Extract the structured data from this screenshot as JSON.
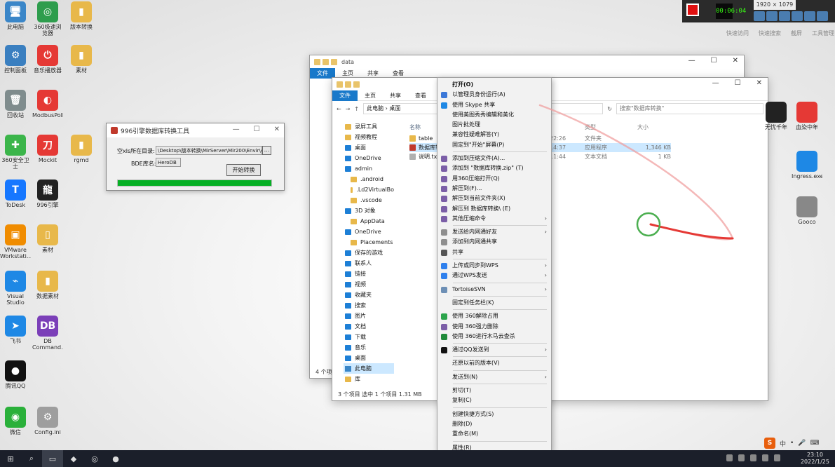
{
  "desktop_icons": [
    {
      "label": "此电脑",
      "color": "#3a86c8",
      "glyph": "🖥"
    },
    {
      "label": "360极速浏览器",
      "color": "#2e9d4d",
      "glyph": "◎"
    },
    {
      "label": "版本转换",
      "color": "#e8b84a",
      "glyph": "▮"
    },
    {
      "label": "控制面板",
      "color": "#3a7fc0",
      "glyph": "⚙"
    },
    {
      "label": "音乐播放器",
      "color": "#e53935",
      "glyph": "⏻"
    },
    {
      "label": "素材",
      "color": "#e8b84a",
      "glyph": "▮"
    },
    {
      "label": "回收站",
      "color": "#7f8c8d",
      "glyph": "🗑"
    },
    {
      "label": "ModbusPoll",
      "color": "#e53935",
      "glyph": "◐"
    },
    {
      "label": "360安全卫士",
      "color": "#3bb54a",
      "glyph": "✚"
    },
    {
      "label": "Mockit",
      "color": "#e53935",
      "glyph": "刀"
    },
    {
      "label": "rgmd",
      "color": "#e8b84a",
      "glyph": "▮"
    },
    {
      "label": "ToDesk",
      "color": "#1677ff",
      "glyph": "T"
    },
    {
      "label": "996引擎",
      "color": "#222222",
      "glyph": "龍"
    },
    {
      "label": "VMware Workstati...",
      "color": "#f08c00",
      "glyph": "▣"
    },
    {
      "label": "素材",
      "color": "#e8b84a",
      "glyph": "▯"
    },
    {
      "label": "Visual Studio Code",
      "color": "#1e88e5",
      "glyph": "⌁"
    },
    {
      "label": "数据素材",
      "color": "#e8b84a",
      "glyph": "▮"
    },
    {
      "label": "飞书",
      "color": "#1e88e5",
      "glyph": "➤"
    },
    {
      "label": "DB Command...",
      "color": "#7b3fb8",
      "glyph": "DB"
    },
    {
      "label": "腾讯QQ",
      "color": "#111111",
      "glyph": "●"
    },
    {
      "label": "微信",
      "color": "#2ab03a",
      "glyph": "◉"
    },
    {
      "label": "Config.ini",
      "color": "#9e9e9e",
      "glyph": "⚙"
    }
  ],
  "recorder": {
    "timer": "00:06:04",
    "resolution": "1920 × 1079"
  },
  "top_labels": [
    "快速访问",
    "快速搜索",
    "截屏",
    "工具管理"
  ],
  "dialog": {
    "title": "996引擎数据库转换工具",
    "path_label": "空xls所在目录:",
    "path_value": "\\Desktop\\版本转换\\MirServer\\Mir200\\Envir\\data",
    "browse": "...",
    "bde_label": "BDE库名:",
    "bde_value": "HeroDB",
    "convert_button": "开始转换",
    "progress": 1.0
  },
  "back_window": {
    "title": "data",
    "tabs": [
      "文件",
      "主页",
      "共享",
      "查看"
    ],
    "status": "4 个项目"
  },
  "front_window": {
    "title": "",
    "tabs": [
      "文件",
      "主页",
      "共享",
      "查看"
    ],
    "path": [
      "此电脑",
      "桌面"
    ],
    "search_placeholder": "搜索\"数据库转换\"",
    "nav": [
      {
        "label": "录屏工具",
        "kind": "folder"
      },
      {
        "label": "视频教程",
        "kind": "folder"
      },
      {
        "label": "桌面",
        "kind": "blue"
      },
      {
        "label": "OneDrive",
        "kind": "cloud"
      },
      {
        "label": "admin",
        "kind": "user"
      },
      {
        "label": ".android",
        "kind": "folder"
      },
      {
        "label": ".Ld2VirtualBo",
        "kind": "folder"
      },
      {
        "label": ".vscode",
        "kind": "folder"
      },
      {
        "label": "3D 对象",
        "kind": "blue"
      },
      {
        "label": "AppData",
        "kind": "folder"
      },
      {
        "label": "OneDrive",
        "kind": "cloud"
      },
      {
        "label": "Placements",
        "kind": "folder"
      },
      {
        "label": "保存的游戏",
        "kind": "blue"
      },
      {
        "label": "联系人",
        "kind": "blue"
      },
      {
        "label": "链接",
        "kind": "blue"
      },
      {
        "label": "视频",
        "kind": "blue"
      },
      {
        "label": "收藏夹",
        "kind": "blue"
      },
      {
        "label": "搜索",
        "kind": "blue"
      },
      {
        "label": "图片",
        "kind": "blue"
      },
      {
        "label": "文档",
        "kind": "blue"
      },
      {
        "label": "下载",
        "kind": "blue"
      },
      {
        "label": "音乐",
        "kind": "blue"
      },
      {
        "label": "桌面",
        "kind": "blue"
      },
      {
        "label": "此电脑",
        "kind": "pc"
      },
      {
        "label": "库",
        "kind": "folder"
      }
    ],
    "columns": {
      "name": "名称",
      "type": "类型",
      "size": "大小"
    },
    "files": [
      {
        "name": "table",
        "date": "22:26",
        "type": "文件夹",
        "size": "",
        "color": "#e8b84a"
      },
      {
        "name": "数据库转",
        "date": "14:37",
        "type": "应用程序",
        "size": "1,346 KB",
        "color": "#c0392b"
      },
      {
        "name": "说明.txt",
        "date": "11:44",
        "type": "文本文档",
        "size": "1 KB",
        "color": "#b0b0b0"
      }
    ],
    "status": "3 个项目     选中 1 个项目  1.31 MB"
  },
  "context_menu": [
    {
      "label": "打开(O)",
      "bold": true
    },
    {
      "label": "以管理员身份运行(A)",
      "icon": "#3b78d8"
    },
    {
      "label": "使用 Skype 共享",
      "icon": "#1e88e5"
    },
    {
      "label": "使用美图秀秀编辑和美化"
    },
    {
      "label": "图片批处理"
    },
    {
      "label": "兼容性疑难解答(Y)"
    },
    {
      "label": "固定到\"开始\"屏幕(P)"
    },
    {
      "sep": true
    },
    {
      "label": "添加到压缩文件(A)...",
      "icon": "#7b5ea7"
    },
    {
      "label": "添加到 \"数据库转换.zip\" (T)",
      "icon": "#7b5ea7"
    },
    {
      "label": "用360压缩打开(Q)",
      "icon": "#7b5ea7"
    },
    {
      "label": "解压到(F)...",
      "icon": "#7b5ea7"
    },
    {
      "label": "解压到当前文件夹(X)",
      "icon": "#7b5ea7"
    },
    {
      "label": "解压到 数据库转换\\ (E)",
      "icon": "#7b5ea7"
    },
    {
      "label": "其他压缩命令",
      "icon": "#7b5ea7",
      "sub": true
    },
    {
      "sep": true
    },
    {
      "label": "发送给内网通好友",
      "icon": "#8e8e8e",
      "sub": true
    },
    {
      "label": "添加到内网通共享",
      "icon": "#8e8e8e"
    },
    {
      "label": "共享",
      "icon": "#555555"
    },
    {
      "sep": true
    },
    {
      "label": "上传或同步到WPS",
      "icon": "#2f80ed",
      "sub": true
    },
    {
      "label": "通过WPS发送",
      "icon": "#2f80ed",
      "sub": true
    },
    {
      "sep": true
    },
    {
      "label": "TortoiseSVN",
      "icon": "#6d8fb5",
      "sub": true
    },
    {
      "sep": true
    },
    {
      "label": "固定到任务栏(K)"
    },
    {
      "sep": true
    },
    {
      "label": "使用 360解除占用",
      "icon": "#2ca44c"
    },
    {
      "label": "使用 360强力删除",
      "icon": "#7b5ea7"
    },
    {
      "label": "使用 360进行木马云查杀",
      "icon": "#1f8a3a"
    },
    {
      "sep": true
    },
    {
      "label": "通过QQ发送到",
      "icon": "#111111",
      "sub": true
    },
    {
      "sep": true
    },
    {
      "label": "还原以前的版本(V)"
    },
    {
      "sep": true
    },
    {
      "label": "发送到(N)",
      "sub": true
    },
    {
      "sep": true
    },
    {
      "label": "剪切(T)"
    },
    {
      "label": "复制(C)"
    },
    {
      "sep": true
    },
    {
      "label": "创建快捷方式(S)"
    },
    {
      "label": "删除(D)"
    },
    {
      "label": "重命名(M)"
    },
    {
      "sep": true
    },
    {
      "label": "属性(R)"
    }
  ],
  "right_icons": [
    {
      "label": "无忧千年",
      "color": "#222222"
    },
    {
      "label": "血染中年",
      "color": "#e53935"
    },
    {
      "label": "Ingress.exe",
      "color": "#1e88e5"
    },
    {
      "label": "Gooco",
      "color": "#888888"
    }
  ],
  "taskbar": {
    "time": "23:10",
    "date": "2022/1/25"
  },
  "ime": {
    "mode": "中"
  }
}
